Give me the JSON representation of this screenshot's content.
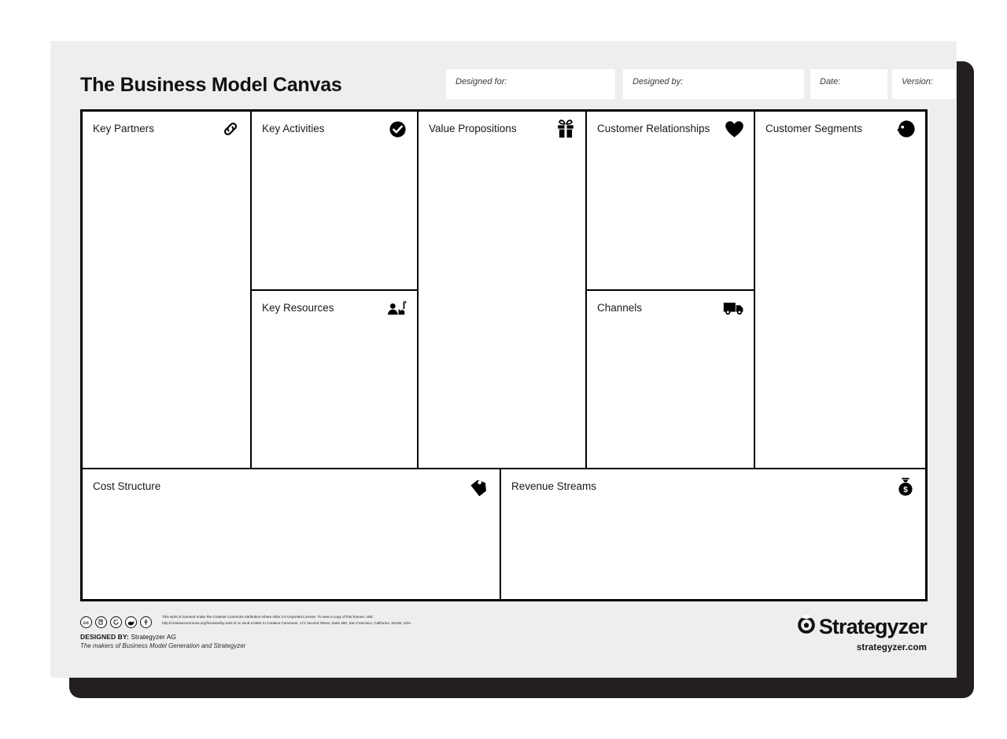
{
  "title": "The Business Model Canvas",
  "header_fields": [
    {
      "id": "designed-for",
      "label": "Designed for:",
      "value": ""
    },
    {
      "id": "designed-by",
      "label": "Designed by:",
      "value": ""
    },
    {
      "id": "date",
      "label": "Date:",
      "value": ""
    },
    {
      "id": "version",
      "label": "Version:",
      "value": ""
    }
  ],
  "blocks": {
    "key_partners": {
      "label": "Key Partners",
      "icon": "chain-link-icon",
      "content": ""
    },
    "key_activities": {
      "label": "Key Activities",
      "icon": "check-circle-icon",
      "content": ""
    },
    "key_resources": {
      "label": "Key Resources",
      "icon": "factory-worker-icon",
      "content": ""
    },
    "value_propositions": {
      "label": "Value Propositions",
      "icon": "gift-icon",
      "content": ""
    },
    "customer_relationships": {
      "label": "Customer Relationships",
      "icon": "heart-icon",
      "content": ""
    },
    "channels": {
      "label": "Channels",
      "icon": "delivery-truck-icon",
      "content": ""
    },
    "customer_segments": {
      "label": "Customer Segments",
      "icon": "person-head-icon",
      "content": ""
    },
    "cost_structure": {
      "label": "Cost Structure",
      "icon": "price-tag-icon",
      "content": ""
    },
    "revenue_streams": {
      "label": "Revenue Streams",
      "icon": "money-bag-icon",
      "content": ""
    }
  },
  "footer": {
    "cc_badges": [
      "cc-icon",
      "cc-by-icon",
      "cc-sa-icon",
      "cc-remix-icon",
      "cc-person-icon"
    ],
    "license_line_1": "This work is licensed under the Creative Commons Attribution-Share Alike 3.0 Unported License. To view a copy of this license, visit:",
    "license_line_2": "http://creativecommons.org/licenses/by-sa/3.0/ or send a letter to Creative Commons, 171 Second Street, Suite 300, San Francisco, California, 94105, USA.",
    "designed_by_prefix": "DESIGNED BY:",
    "designed_by_value": "Strategyzer AG",
    "makers_line": "The makers of Business Model Generation and Strategyzer",
    "brand_name": "Strategyzer",
    "brand_url": "strategyzer.com",
    "brand_mark": "strategyzer-owl-icon"
  },
  "colors": {
    "page_background": "#ffffff",
    "sheet_background": "#eeeeee",
    "cell_background": "#ffffff",
    "line": "#000000",
    "text": "#111111",
    "shadow": "#241f1f"
  }
}
